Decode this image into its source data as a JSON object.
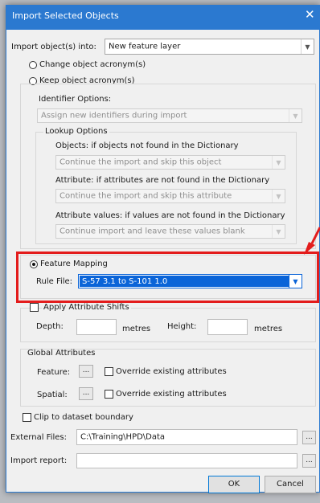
{
  "window": {
    "title": "Import Selected Objects",
    "close_glyph": "✕"
  },
  "import_into": {
    "label": "Import object(s) into:",
    "value": "New feature layer"
  },
  "options": {
    "change_acronym": "Change object acronym(s)",
    "keep_acronym": "Keep object acronym(s)"
  },
  "identifier": {
    "heading": "Identifier Options:",
    "value": "Assign new identifiers during import"
  },
  "lookup": {
    "heading": "Lookup Options",
    "objects_label": "Objects: if objects not found in the Dictionary",
    "objects_value": "Continue the import and skip this object",
    "attribute_label": "Attribute: if attributes are not found in the Dictionary",
    "attribute_value": "Continue the import and skip this attribute",
    "values_label": "Attribute values: if values are not found in the Dictionary",
    "values_value": "Continue import and leave these values blank"
  },
  "feature_mapping": {
    "label": "Feature  Mapping",
    "rule_label": "Rule File:",
    "rule_value": "S-57 3.1 to S-101 1.0"
  },
  "shifts": {
    "label": "Apply Attribute Shifts",
    "depth_label": "Depth:",
    "height_label": "Height:",
    "unit": "metres"
  },
  "global_attrs": {
    "heading": "Global Attributes",
    "feature_label": "Feature:",
    "spatial_label": "Spatial:",
    "browse": "...",
    "override": "Override existing attributes"
  },
  "clip": {
    "label": "Clip to dataset boundary"
  },
  "external": {
    "label": "External Files:",
    "value": "C:\\Training\\HPD\\Data",
    "browse": "..."
  },
  "report": {
    "label": "Import report:",
    "value": "",
    "browse": "..."
  },
  "buttons": {
    "ok": "OK",
    "cancel": "Cancel"
  },
  "colors": {
    "titlebar": "#2b79d0",
    "selection": "#0a64d8",
    "highlight": "#e31c1c"
  },
  "icons": {
    "dropdown": "chevron-down-icon",
    "close": "close-icon",
    "annotation": "red-arrow-icon"
  }
}
